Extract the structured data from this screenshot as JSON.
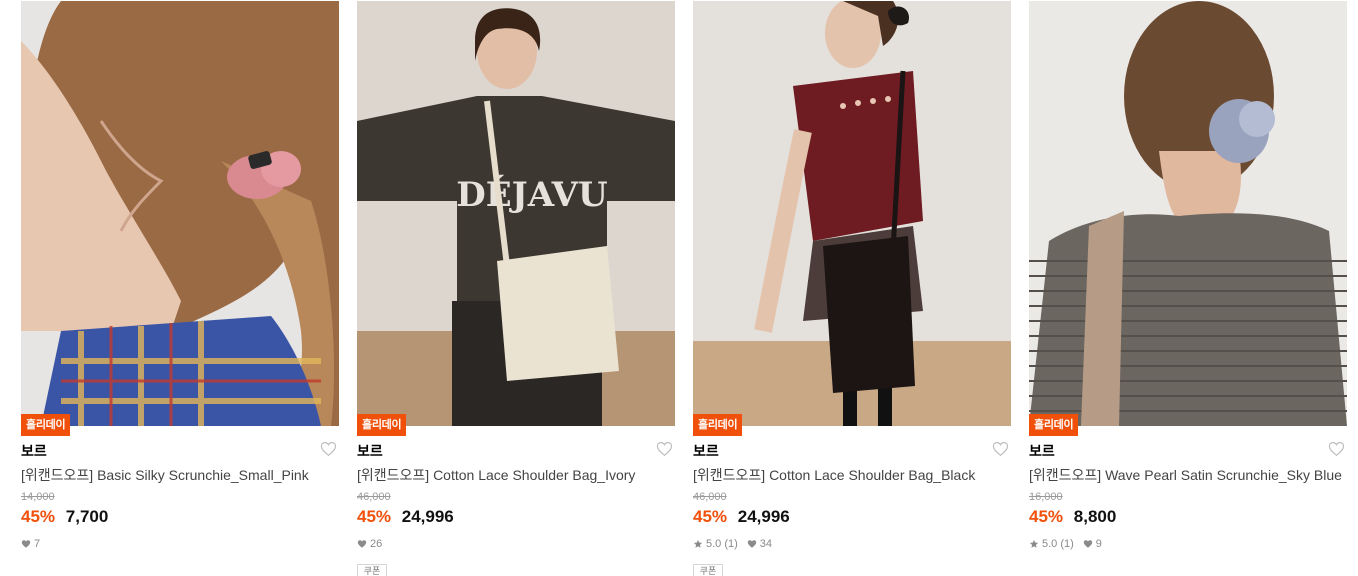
{
  "products": [
    {
      "badge": "홀리데이",
      "brand": "보르",
      "name": "[위캔드오프] Basic Silky Scrunchie_Small_Pink",
      "original_price": "14,000",
      "discount": "45%",
      "price": "7,700",
      "rating": "",
      "likes": "7",
      "coupon": "",
      "image": "woman-ponytail-pink-scrunchie-plaid-top"
    },
    {
      "badge": "홀리데이",
      "brand": "보르",
      "name": "[위캔드오프] Cotton Lace Shoulder Bag_Ivory",
      "original_price": "46,000",
      "discount": "45%",
      "price": "24,996",
      "rating": "",
      "likes": "26",
      "coupon": "쿠폰",
      "image": "woman-brown-sweatshirt-ivory-bag"
    },
    {
      "badge": "홀리데이",
      "brand": "보르",
      "name": "[위캔드오프] Cotton Lace Shoulder Bag_Black",
      "original_price": "46,000",
      "discount": "45%",
      "price": "24,996",
      "rating": "5.0 (1)",
      "likes": "34",
      "coupon": "쿠폰",
      "image": "woman-red-knit-vest-black-bag"
    },
    {
      "badge": "홀리데이",
      "brand": "보르",
      "name": "[위캔드오프] Wave Pearl Satin Scrunchie_Sky Blue",
      "original_price": "16,000",
      "discount": "45%",
      "price": "8,800",
      "rating": "5.0 (1)",
      "likes": "9",
      "coupon": "",
      "image": "woman-bun-blue-scrunchie-striped-top"
    }
  ],
  "colors": {
    "accent": "#f0500a",
    "text": "#111111",
    "muted": "#8a8a8a"
  }
}
